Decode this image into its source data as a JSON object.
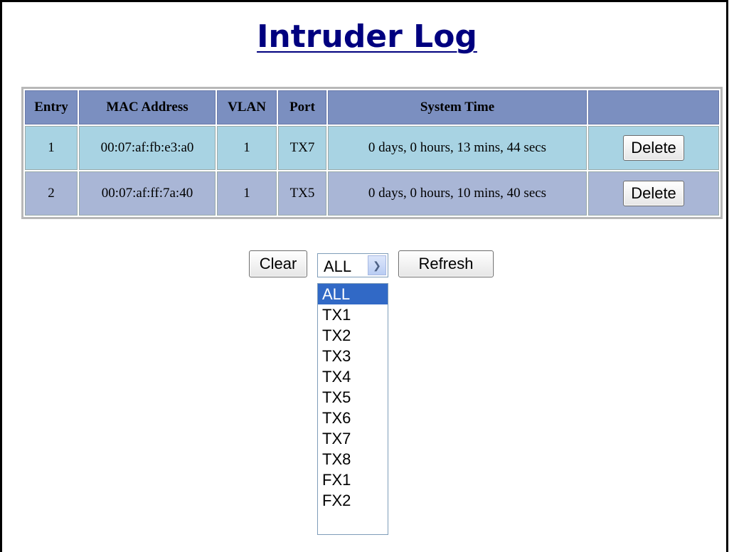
{
  "title": "Intruder Log",
  "table": {
    "headers": [
      "Entry",
      "MAC Address",
      "VLAN",
      "Port",
      "System Time",
      ""
    ],
    "rows": [
      {
        "entry": "1",
        "mac": "00:07:af:fb:e3:a0",
        "vlan": "1",
        "port": "TX7",
        "time": "0 days, 0 hours, 13 mins, 44 secs",
        "action": "Delete"
      },
      {
        "entry": "2",
        "mac": "00:07:af:ff:7a:40",
        "vlan": "1",
        "port": "TX5",
        "time": "0 days, 0 hours, 10 mins, 40 secs",
        "action": "Delete"
      }
    ]
  },
  "controls": {
    "clear_label": "Clear",
    "refresh_label": "Refresh",
    "port_select": {
      "value": "ALL",
      "options": [
        "ALL",
        "TX1",
        "TX2",
        "TX3",
        "TX4",
        "TX5",
        "TX6",
        "TX7",
        "TX8",
        "FX1",
        "FX2"
      ]
    }
  },
  "colors": {
    "title": "#00007f",
    "header_bg": "#7b8fc0",
    "row_a_bg": "#a8d3e3",
    "row_b_bg": "#a9b6d6",
    "option_selected_bg": "#3169c6"
  }
}
